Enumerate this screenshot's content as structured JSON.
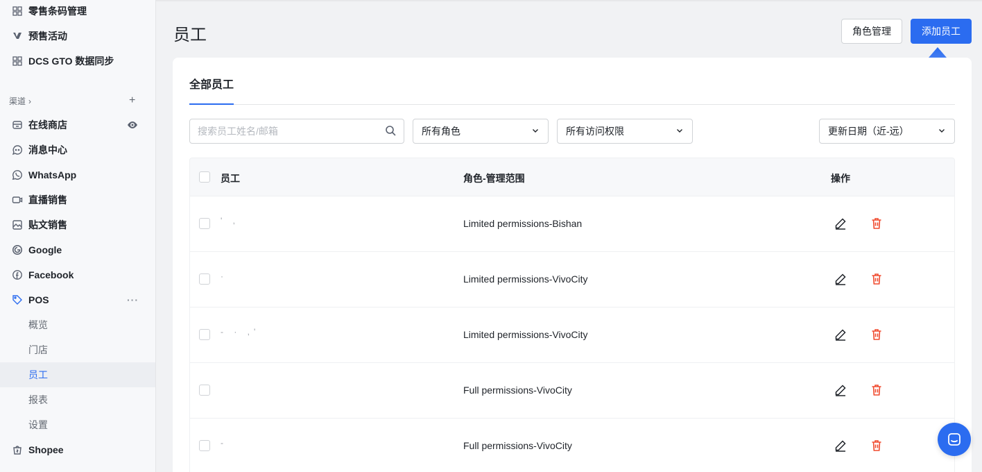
{
  "sidebar": {
    "top_items": [
      {
        "label": "零售条码管理",
        "icon": "grid-icon"
      },
      {
        "label": "预售活动",
        "icon": "presale-icon"
      },
      {
        "label": "DCS GTO 数据同步",
        "icon": "grid-icon"
      }
    ],
    "section_label": "渠道",
    "section_chevron": "›",
    "section_add": "+",
    "channels": [
      {
        "label": "在线商店",
        "icon": "store-icon"
      },
      {
        "label": "消息中心",
        "icon": "message-icon"
      },
      {
        "label": "WhatsApp",
        "icon": "whatsapp-icon"
      },
      {
        "label": "直播销售",
        "icon": "live-icon"
      },
      {
        "label": "贴文销售",
        "icon": "post-icon"
      },
      {
        "label": "Google",
        "icon": "google-icon"
      },
      {
        "label": "Facebook",
        "icon": "facebook-icon"
      },
      {
        "label": "POS",
        "icon": "pos-tag-icon"
      }
    ],
    "pos_more": "···",
    "pos_sub": [
      "概览",
      "门店",
      "员工",
      "报表",
      "设置"
    ],
    "active_sub": "员工",
    "bottom_item": {
      "label": "Shopee",
      "icon": "shopee-icon"
    }
  },
  "header": {
    "title": "员工",
    "role_button": "角色管理",
    "add_button": "添加员工"
  },
  "card": {
    "tab": "全部员工",
    "search_placeholder": "搜索员工姓名/邮箱",
    "filter_role": "所有角色",
    "filter_access": "所有访问权限",
    "sort": "更新日期（近-远）",
    "columns": {
      "employee": "员工",
      "role": "角色-管理范围",
      "actions": "操作"
    },
    "rows": [
      {
        "name": "'  ,",
        "role": "Limited permissions-Bishan"
      },
      {
        "name": "  ·",
        "role": "Limited permissions-VivoCity"
      },
      {
        "name": "  - · ,'",
        "role": "Limited permissions-VivoCity"
      },
      {
        "name": "",
        "role": "Full permissions-VivoCity"
      },
      {
        "name": "    -",
        "role": "Full permissions-VivoCity"
      }
    ]
  },
  "colors": {
    "accent": "#2b6cf0",
    "danger": "#f04a2e"
  }
}
